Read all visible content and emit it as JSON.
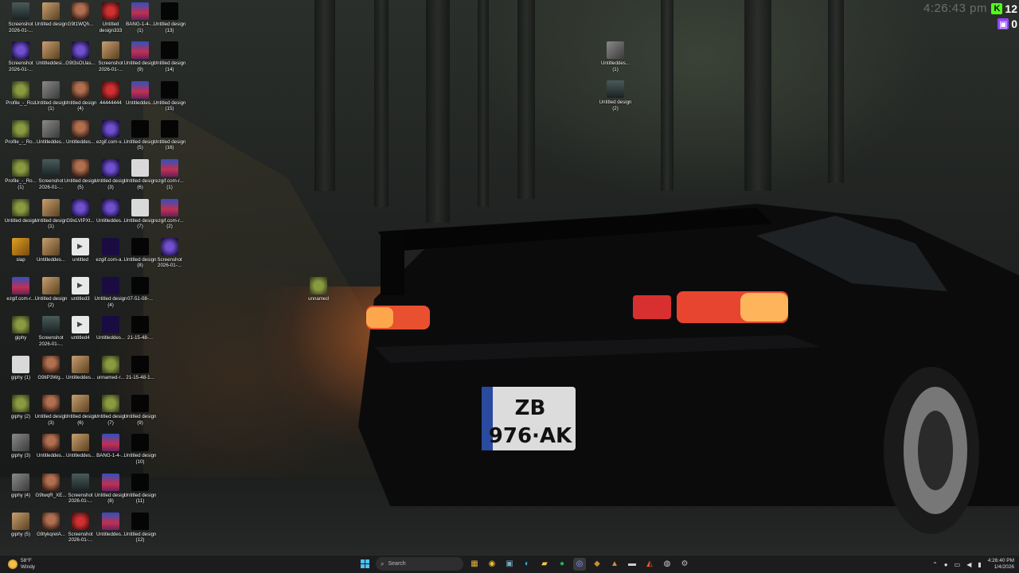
{
  "overlay": {
    "clock": "4:26:43 pm",
    "kick_count": "12",
    "twitch_count": "0"
  },
  "desktop_icons": [
    {
      "label": "Screenshot 2026-01-...",
      "kind": "screen"
    },
    {
      "label": "Untitled design",
      "kind": "tan"
    },
    {
      "label": "G9t1WQh...",
      "kind": "face"
    },
    {
      "label": "Untitled design333",
      "kind": "red"
    },
    {
      "label": "BANG-1-4-... (1)",
      "kind": "bang"
    },
    {
      "label": "Untitled design (13)",
      "kind": "black"
    },
    {
      "label": "Screenshot 2026-01-...",
      "kind": "purple"
    },
    {
      "label": "Untitleddesi...",
      "kind": "tan"
    },
    {
      "label": "G9t3sOUas...",
      "kind": "purple"
    },
    {
      "label": "Screenshot 2026-01-...",
      "kind": "tan"
    },
    {
      "label": "Untitled design (9)",
      "kind": "bang"
    },
    {
      "label": "Untitled design (14)",
      "kind": "black"
    },
    {
      "label": "Profile_-_Roz",
      "kind": "pepe"
    },
    {
      "label": "Untitled design (1)",
      "kind": "gray"
    },
    {
      "label": "Untitled design (4)",
      "kind": "face"
    },
    {
      "label": "44444444",
      "kind": "red"
    },
    {
      "label": "Untitleddes...",
      "kind": "bang"
    },
    {
      "label": "Untitled design (15)",
      "kind": "black"
    },
    {
      "label": "Profile_-_Ro...",
      "kind": "pepe"
    },
    {
      "label": "Untitleddes...",
      "kind": "gray"
    },
    {
      "label": "Untitleddes...",
      "kind": "face"
    },
    {
      "label": "ezgif.com-v...",
      "kind": "purple"
    },
    {
      "label": "Untitled design (5)",
      "kind": "black"
    },
    {
      "label": "Untitled design (16)",
      "kind": "black"
    },
    {
      "label": "Profile_-_Ro... (1)",
      "kind": "pepe"
    },
    {
      "label": "Screenshot 2026-01-...",
      "kind": "screen"
    },
    {
      "label": "Untitled design (5)",
      "kind": "face"
    },
    {
      "label": "Untitled design (3)",
      "kind": "purple"
    },
    {
      "label": "Untitled design (6)",
      "kind": "white"
    },
    {
      "label": "ezgif.com-r... (1)",
      "kind": "bang"
    },
    {
      "label": "Untitled design",
      "kind": "pepe"
    },
    {
      "label": "Untitled design (1)",
      "kind": "tan"
    },
    {
      "label": "G9xLVIPXt...",
      "kind": "purple"
    },
    {
      "label": "Untitleddes...",
      "kind": "purple"
    },
    {
      "label": "Untitled design (7)",
      "kind": "white"
    },
    {
      "label": "ezgif.com-r... (2)",
      "kind": "bang"
    },
    {
      "label": "slap",
      "kind": "gold"
    },
    {
      "label": "Untitleddes...",
      "kind": "tan"
    },
    {
      "label": "untitled",
      "kind": "file"
    },
    {
      "label": "ezgif.com-a...",
      "kind": "dark"
    },
    {
      "label": "Untitled design (8)",
      "kind": "black"
    },
    {
      "label": "Screenshot 2026-01-...",
      "kind": "purple"
    },
    {
      "label": "ezgif.com-r...",
      "kind": "bang"
    },
    {
      "label": "Untitled design (2)",
      "kind": "tan"
    },
    {
      "label": "untitled3",
      "kind": "file"
    },
    {
      "label": "Untitled design (4)",
      "kind": "dark"
    },
    {
      "label": "07-51-08-...",
      "kind": "black"
    },
    {
      "label": "giphy",
      "kind": "pepe"
    },
    {
      "label": "Screenshot 2026-01-...",
      "kind": "screen"
    },
    {
      "label": "untitled4",
      "kind": "file"
    },
    {
      "label": "Untitleddes...",
      "kind": "dark"
    },
    {
      "label": "21-15-48-...",
      "kind": "black"
    },
    {
      "label": "giphy (1)",
      "kind": "white"
    },
    {
      "label": "G9tiP3Wg...",
      "kind": "face"
    },
    {
      "label": "Untitleddes...",
      "kind": "tan"
    },
    {
      "label": "unnamed-r...",
      "kind": "pepe"
    },
    {
      "label": "21-15-48-1...",
      "kind": "black"
    },
    {
      "label": "giphy (2)",
      "kind": "pepe"
    },
    {
      "label": "Untitled design (3)",
      "kind": "face"
    },
    {
      "label": "Untitled design (6)",
      "kind": "tan"
    },
    {
      "label": "Untitled design (7)",
      "kind": "pepe"
    },
    {
      "label": "Untitled design (9)",
      "kind": "black"
    },
    {
      "label": "giphy (3)",
      "kind": "gray"
    },
    {
      "label": "Untitleddes...",
      "kind": "face"
    },
    {
      "label": "Untitleddes...",
      "kind": "tan"
    },
    {
      "label": "BANG-1-4-...",
      "kind": "bang"
    },
    {
      "label": "Untitled design (10)",
      "kind": "black"
    },
    {
      "label": "giphy (4)",
      "kind": "gray"
    },
    {
      "label": "G9twqR_XE...",
      "kind": "face"
    },
    {
      "label": "Screenshot 2026-01-...",
      "kind": "screen"
    },
    {
      "label": "Untitled design (8)",
      "kind": "bang"
    },
    {
      "label": "Untitled design (11)",
      "kind": "black"
    },
    {
      "label": "giphy (5)",
      "kind": "tan"
    },
    {
      "label": "G9tykqrelA...",
      "kind": "face"
    },
    {
      "label": "Screenshot 2026-01-...",
      "kind": "red"
    },
    {
      "label": "Untitleddes...",
      "kind": "bang"
    },
    {
      "label": "Untitled design (12)",
      "kind": "black"
    }
  ],
  "floating_icons": [
    {
      "label": "Untitleddes... (1)",
      "kind": "gray"
    },
    {
      "label": "Untitled design (2)",
      "kind": "screen"
    },
    {
      "label": "unnamed",
      "kind": "pepe"
    }
  ],
  "taskbar": {
    "weather_temp": "58°F",
    "weather_desc": "Windy",
    "search_placeholder": "Search",
    "time": "4:26:40 PM",
    "date": "1/4/2026"
  },
  "taskbar_apps": [
    {
      "name": "widgets-icon",
      "glyph": "▦",
      "color": "#e0b040"
    },
    {
      "name": "chrome-icon",
      "glyph": "◉",
      "color": "#f0c030"
    },
    {
      "name": "task-view-icon",
      "glyph": "▣",
      "color": "#7ab"
    },
    {
      "name": "edge-icon",
      "glyph": "◐",
      "color": "#3bb0e0"
    },
    {
      "name": "file-explorer-icon",
      "glyph": "▰",
      "color": "#f2c744"
    },
    {
      "name": "spotify-icon",
      "glyph": "●",
      "color": "#1db954"
    },
    {
      "name": "discord-icon",
      "glyph": "◎",
      "color": "#8a9cff"
    },
    {
      "name": "app-icon",
      "glyph": "◆",
      "color": "#c89030"
    },
    {
      "name": "adobe-icon",
      "glyph": "▲",
      "color": "#d88a40"
    },
    {
      "name": "terminal-icon",
      "glyph": "▬",
      "color": "#ccc"
    },
    {
      "name": "brave-icon",
      "glyph": "◭",
      "color": "#fb542b"
    },
    {
      "name": "obs-icon",
      "glyph": "◍",
      "color": "#ccc"
    },
    {
      "name": "settings-icon",
      "glyph": "⚙",
      "color": "#bbb"
    }
  ]
}
